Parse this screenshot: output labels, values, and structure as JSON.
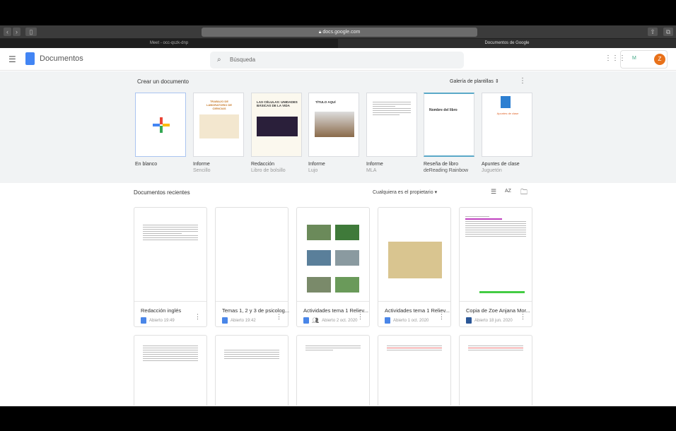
{
  "browser": {
    "url": "docs.google.com",
    "tabs": [
      "Meet - occ-qszk-dnp",
      "Documentos de Google"
    ]
  },
  "header": {
    "app_name": "Documentos",
    "search_placeholder": "Búsqueda",
    "avatar_letter": "Z",
    "account_logo": "M"
  },
  "templates": {
    "title": "Crear un documento",
    "gallery_label": "Galería de plantillas",
    "items": [
      {
        "name": "En blanco",
        "sub": ""
      },
      {
        "name": "Informe",
        "sub": "Sencillo",
        "thumb_title": "TRABAJO DE LABORATORIO DE CIENCIAS"
      },
      {
        "name": "Redacción",
        "sub": "Libro de bolsillo",
        "thumb_title": "LAS CÉLULAS: UNIDADES BÁSICAS DE LA VIDA"
      },
      {
        "name": "Informe",
        "sub": "Lujo",
        "thumb_title": "TÍTULO AQUÍ"
      },
      {
        "name": "Informe",
        "sub": "MLA"
      },
      {
        "name": "Reseña de libro",
        "sub": "deReading Rainbow",
        "thumb_title": "Nombre del libro"
      },
      {
        "name": "Apuntes de clase",
        "sub": "Juguetón",
        "thumb_title": "Apuntes de clase"
      }
    ]
  },
  "recent": {
    "title": "Documentos recientes",
    "owner_filter": "Cualquiera es el propietario",
    "docs": [
      {
        "name": "Redacción inglés",
        "meta": "Abierto 19:49",
        "type": "docs",
        "shared": false
      },
      {
        "name": "Temas 1, 2 y 3 de psicolog...",
        "meta": "Abierto 19:42",
        "type": "docs",
        "shared": false
      },
      {
        "name": "Actividades tema 1 Reliev...",
        "meta": "Abierto 2 oct. 2020",
        "type": "docs",
        "shared": true
      },
      {
        "name": "Actividades tema 1 Reliev...",
        "meta": "Abierto 1 oct. 2020",
        "type": "docs",
        "shared": false
      },
      {
        "name": "Copia de Zoe Anjana Mor...",
        "meta": "Abierto 18 jun. 2020",
        "type": "word",
        "shared": false
      }
    ]
  },
  "colors": {
    "docs_blue": "#4285f4",
    "avatar": "#e8711a"
  }
}
